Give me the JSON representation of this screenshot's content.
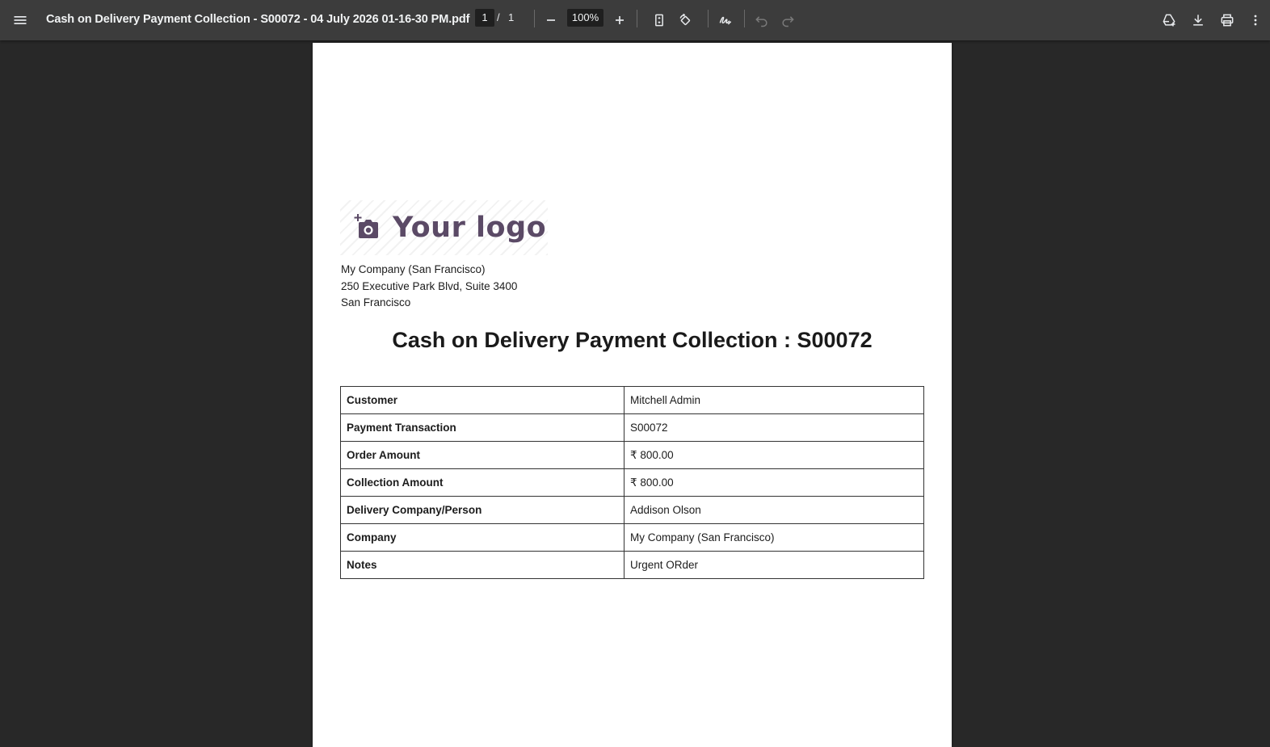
{
  "toolbar": {
    "doc_title": "Cash on Delivery Payment Collection - S00072 - 04 July 2026 01-16-30 PM.pdf",
    "page_current": "1",
    "page_separator": "/",
    "page_total": "1",
    "zoom_level": "100%",
    "icons": {
      "menu": "menu-icon",
      "zoom_out": "minus-icon",
      "zoom_in": "plus-icon",
      "fit": "fit-page-icon",
      "rotate": "rotate-icon",
      "draw": "annotate-icon",
      "undo": "undo-icon",
      "redo": "redo-icon",
      "drive": "drive-add-icon",
      "download": "download-icon",
      "print": "print-icon",
      "more": "more-vert-icon"
    }
  },
  "document": {
    "logo_text": "Your logo",
    "company": {
      "name": "My Company (San Francisco)",
      "street": "250 Executive Park Blvd, Suite 3400",
      "city": "San Francisco"
    },
    "title": "Cash on Delivery Payment Collection : S00072",
    "rows": [
      {
        "label": "Customer",
        "value": "Mitchell Admin"
      },
      {
        "label": "Payment Transaction",
        "value": "S00072"
      },
      {
        "label": "Order Amount",
        "value": "₹ 800.00"
      },
      {
        "label": "Collection Amount",
        "value": "₹ 800.00"
      },
      {
        "label": "Delivery Company/Person",
        "value": "Addison Olson"
      },
      {
        "label": "Company",
        "value": "My Company (San Francisco)"
      },
      {
        "label": "Notes",
        "value": "Urgent ORder"
      }
    ]
  },
  "colors": {
    "toolbar_bg": "#3c3c3c",
    "viewer_bg": "#282828",
    "logo_color": "#5b4a66"
  }
}
